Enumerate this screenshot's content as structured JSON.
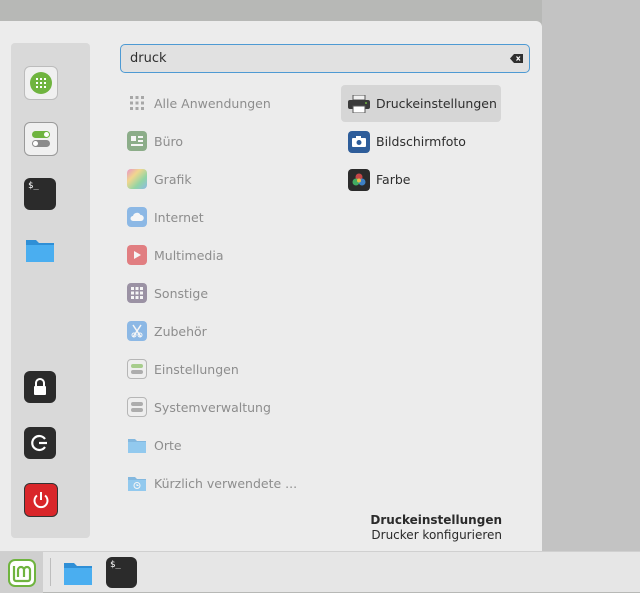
{
  "search": {
    "value": "druck"
  },
  "sidebar": {
    "items": [
      {
        "name": "grid-icon"
      },
      {
        "name": "toggle-icon"
      },
      {
        "name": "terminal-icon",
        "text": "$_"
      },
      {
        "name": "folder-icon"
      },
      {
        "name": "lock-icon"
      },
      {
        "name": "logout-icon"
      },
      {
        "name": "power-icon"
      }
    ]
  },
  "categories": [
    {
      "label": "Alle Anwendungen",
      "icon": "all-apps-icon"
    },
    {
      "label": "Büro",
      "icon": "office-icon"
    },
    {
      "label": "Grafik",
      "icon": "graphics-icon"
    },
    {
      "label": "Internet",
      "icon": "internet-icon"
    },
    {
      "label": "Multimedia",
      "icon": "multimedia-icon"
    },
    {
      "label": "Sonstige",
      "icon": "other-icon"
    },
    {
      "label": "Zubehör",
      "icon": "accessories-icon"
    },
    {
      "label": "Einstellungen",
      "icon": "settings-icon"
    },
    {
      "label": "Systemverwaltung",
      "icon": "administration-icon"
    },
    {
      "label": "Orte",
      "icon": "places-icon"
    },
    {
      "label": "Kürzlich verwendete ...",
      "icon": "recent-icon"
    }
  ],
  "results": [
    {
      "label": "Druckeinstellungen",
      "icon": "printer-icon",
      "selected": true
    },
    {
      "label": "Bildschirmfoto",
      "icon": "screenshot-icon"
    },
    {
      "label": "Farbe",
      "icon": "color-icon"
    }
  ],
  "description": {
    "title": "Druckeinstellungen",
    "subtitle": "Drucker konfigurieren"
  },
  "taskbar": {
    "terminal_text": "$_"
  },
  "colors": {
    "accent": "#4e9ad3",
    "green": "#6fb43f",
    "red": "#d9262a"
  }
}
